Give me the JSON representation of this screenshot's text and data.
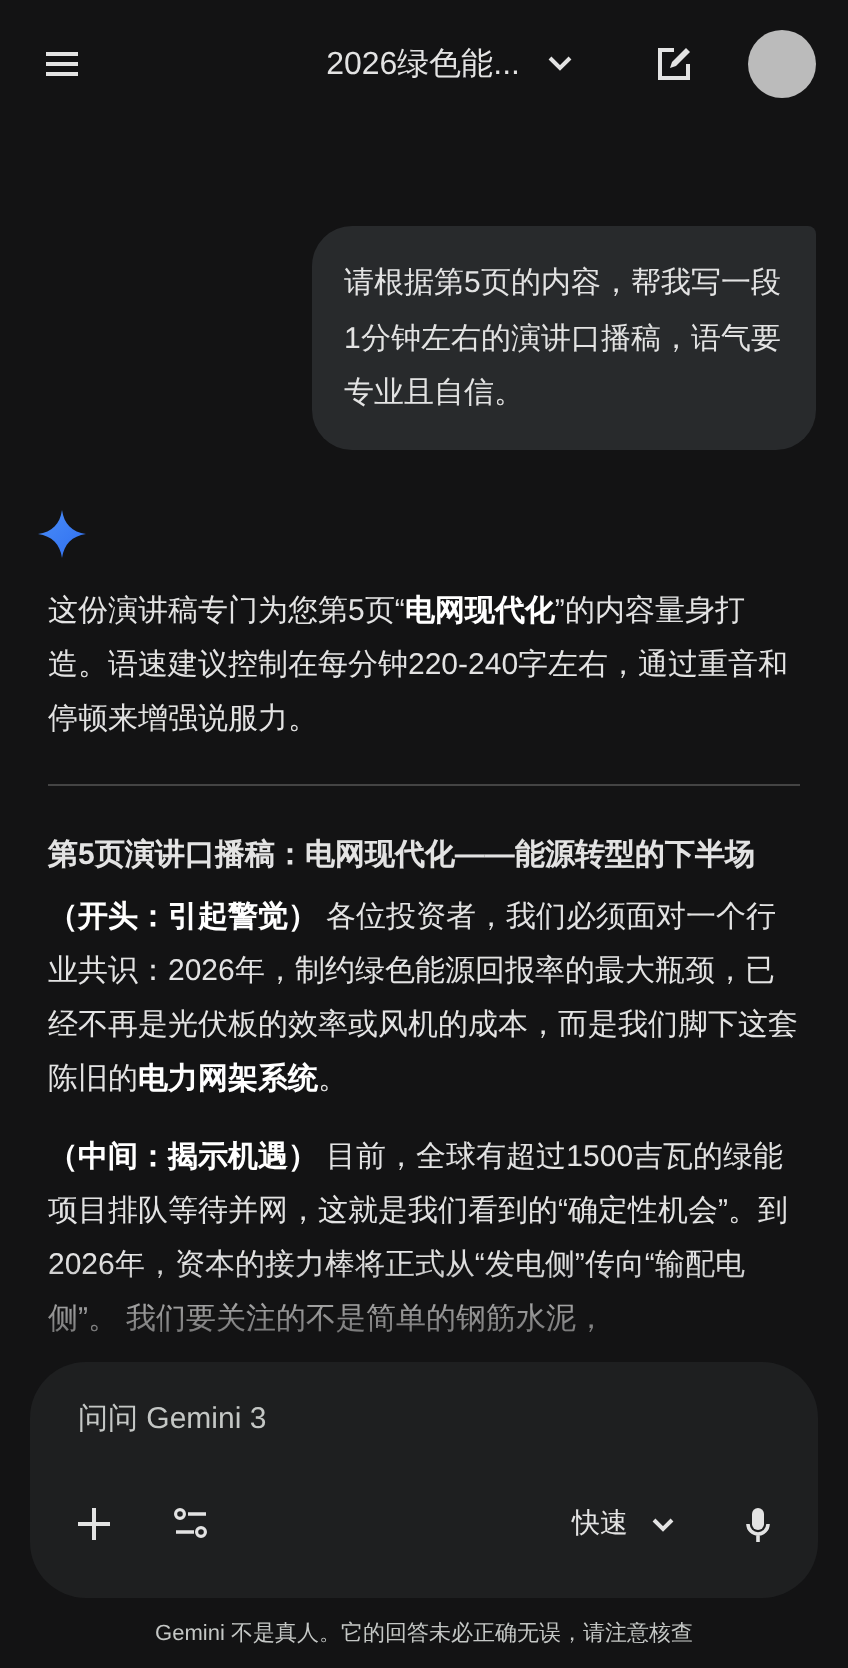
{
  "header": {
    "title": "2026绿色能..."
  },
  "user_message": {
    "text": "请根据第5页的内容，帮我写一段1分钟左右的演讲口播稿，语气要专业且自信。"
  },
  "response": {
    "intro": "这份演讲稿专门为您第5页“**电网现代化**”的内容量身打造。语速建议控制在每分钟220-240字左右，通过重音和停顿来增强说服力。",
    "heading": "第5页演讲口播稿：电网现代化——能源转型的下半场",
    "paragraphs": [
      {
        "text": "**（开头：引起警觉）** 各位投资者，我们必须面对一个行业共识：2026年，制约绿色能源回报率的最大瓶颈，已经不再是光伏板的效率或风机的成本，而是我们脚下这套陈旧的**电力网架系统**。",
        "faded": false
      },
      {
        "text": "**（中间：揭示机遇）** 目前，全球有超过1500吉瓦的绿能项目排队等待并网，这就是我们看到的“确定性机会”。到2026年，资本的接力棒将正式从“发电侧”传向“输配电侧”。 我们要关注的不是简单的钢筋水泥，",
        "faded": true
      }
    ]
  },
  "composer": {
    "placeholder": "问问 Gemini 3",
    "mode": "快速"
  },
  "disclaimer": "Gemini 不是真人。它的回答未必正确无误，请注意核查"
}
